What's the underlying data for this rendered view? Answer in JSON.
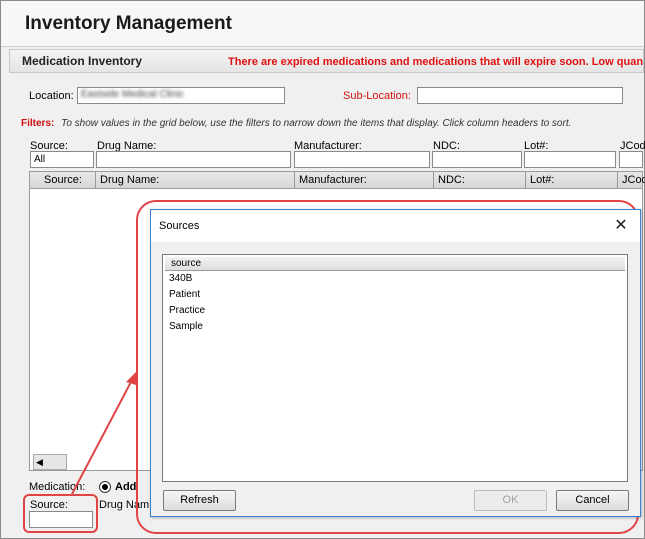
{
  "app": {
    "title": "Inventory Management"
  },
  "section": {
    "title": "Medication Inventory",
    "warning": "There are expired medications and medications that will expire soon.   Low quan"
  },
  "location": {
    "label": "Location:",
    "value": "Eastside Medical Clinic",
    "sub_label": "Sub-Location:",
    "sub_value": ""
  },
  "filters": {
    "key": "Filters:",
    "description": "To show values in the grid below, use the filters to narrow down the items that display. Click column headers to sort.",
    "columns": [
      {
        "label": "Source:",
        "value": "All"
      },
      {
        "label": "Drug Name:",
        "value": ""
      },
      {
        "label": "Manufacturer:",
        "value": ""
      },
      {
        "label": "NDC:",
        "value": ""
      },
      {
        "label": "Lot#:",
        "value": ""
      },
      {
        "label": "JCode",
        "value": ""
      }
    ]
  },
  "grid": {
    "headers": [
      "Source:",
      "Drug Name:",
      "Manufacturer:",
      "NDC:",
      "Lot#:",
      "JCod"
    ]
  },
  "medication": {
    "label": "Medication:",
    "radio_label": "Add",
    "source_label": "Source:",
    "drug_label": "Drug Nam"
  },
  "dialog": {
    "title": "Sources",
    "column": "source",
    "items": [
      "340B",
      "Patient",
      "Practice",
      "Sample"
    ],
    "refresh": "Refresh",
    "ok": "OK",
    "cancel": "Cancel"
  },
  "colors": {
    "warning": "#e01010",
    "highlight": "#e04444",
    "dialog_border": "#3a7fd0"
  }
}
